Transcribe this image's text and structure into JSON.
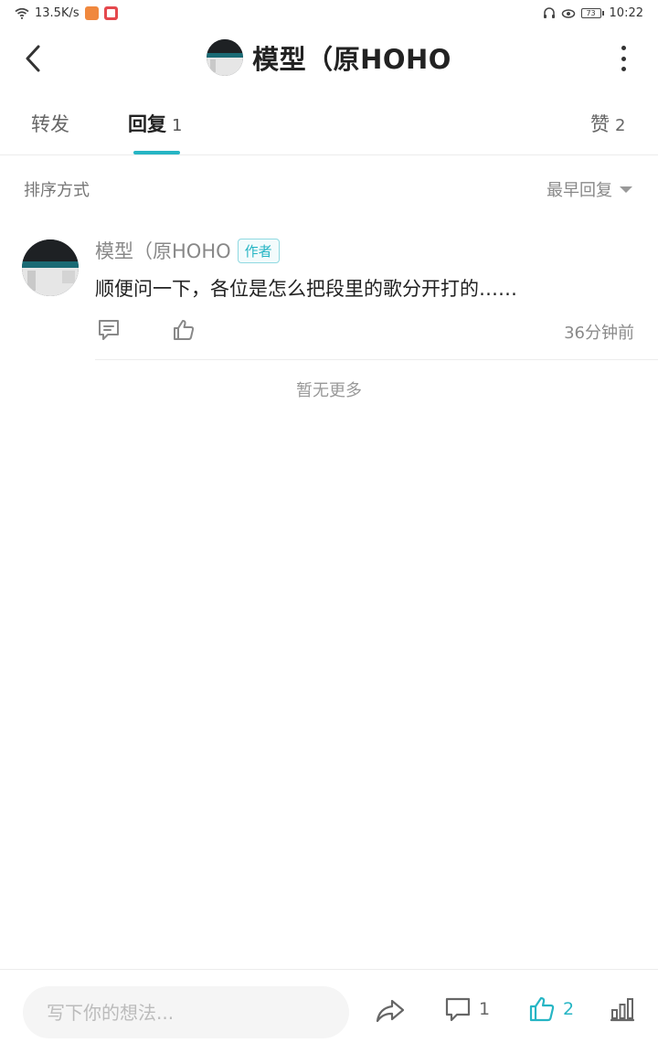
{
  "status_bar": {
    "network_speed": "13.5K/s",
    "battery": "73",
    "time": "10:22"
  },
  "header": {
    "title": "模型（原HOHO"
  },
  "tabs": [
    {
      "label": "转发",
      "count": ""
    },
    {
      "label": "回复",
      "count": "1"
    },
    {
      "label": "赞",
      "count": "2"
    }
  ],
  "sort": {
    "label": "排序方式",
    "selected": "最早回复"
  },
  "reply": {
    "author": "模型（原HOHO",
    "tag": "作者",
    "text": "顺便问一下，各位是怎么把段里的歌分开打的……",
    "time": "36分钟前"
  },
  "no_more": "暂无更多",
  "bottom_bar": {
    "input_placeholder": "写下你的想法...",
    "comment_count": "1",
    "like_count": "2"
  },
  "colors": {
    "accent": "#26b5c4",
    "text_primary": "#222222",
    "text_secondary": "#888888"
  }
}
